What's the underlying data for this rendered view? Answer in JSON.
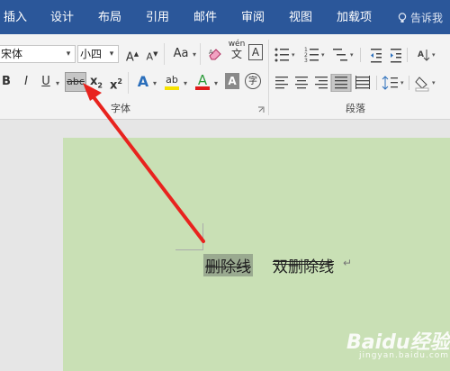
{
  "tabs": [
    "插入",
    "设计",
    "布局",
    "引用",
    "邮件",
    "审阅",
    "视图",
    "加载项"
  ],
  "tell_me": "告诉我",
  "font": {
    "name": "宋体",
    "size": "小四",
    "group_label": "字体",
    "buttons": {
      "grow": "A",
      "shrink": "A",
      "change_case": "Aa",
      "clear_format": "",
      "phonetic": "wén",
      "phonetic_char": "文",
      "char_border": "A",
      "bold": "B",
      "italic": "I",
      "underline": "U",
      "strike": "abc",
      "subscript": "x",
      "superscript": "x",
      "text_effects": "A",
      "highlight": "ab",
      "font_color": "A",
      "char_shading": "A",
      "enclose": "字"
    }
  },
  "paragraph": {
    "group_label": "段落"
  },
  "document": {
    "text1": "删除线",
    "text2": "双删除线",
    "para_mark": "↵"
  },
  "watermark": {
    "brand": "Baidu经验",
    "sub": "jingyan.baidu.com"
  },
  "colors": {
    "tab_bar": "#2b579a",
    "page_bg": "#c9e0b5",
    "arrow": "#e8231e",
    "highlight_yellow": "#f6e200",
    "font_red": "#e01b1b",
    "font_green": "#2c9b3a"
  }
}
